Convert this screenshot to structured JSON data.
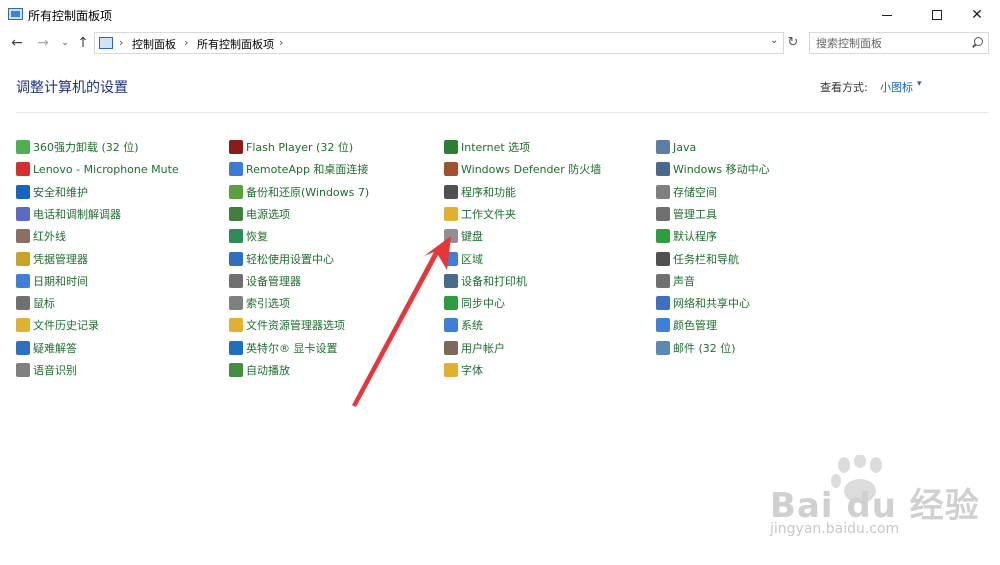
{
  "window": {
    "title": "所有控制面板项",
    "minimize_icon": "minimize-icon",
    "maximize_icon": "maximize-icon",
    "close_glyph": "✕"
  },
  "nav": {
    "back_glyph": "←",
    "forward_glyph": "→",
    "recent_glyph": "⌄",
    "up_glyph": "↑",
    "breadcrumb": [
      "控制面板",
      "所有控制面板项"
    ],
    "separator": "›",
    "dropdown_glyph": "⌄",
    "refresh_glyph": "↻"
  },
  "search": {
    "placeholder": "搜索控制面板"
  },
  "header": {
    "title": "调整计算机的设置",
    "view_label": "查看方式:",
    "view_value": "小图标",
    "view_caret": "▾"
  },
  "columns": [
    [
      {
        "label": "360强力卸载 (32 位)",
        "icon": "uninstall-icon",
        "color": "#4caf50"
      },
      {
        "label": "Lenovo - Microphone Mute",
        "icon": "lenovo-mute-icon",
        "color": "#d32f2f"
      },
      {
        "label": "安全和维护",
        "icon": "flag-icon",
        "color": "#1565c0"
      },
      {
        "label": "电话和调制解调器",
        "icon": "modem-icon",
        "color": "#5c6bc0"
      },
      {
        "label": "红外线",
        "icon": "infrared-icon",
        "color": "#8d6e63"
      },
      {
        "label": "凭据管理器",
        "icon": "credential-icon",
        "color": "#c9a227"
      },
      {
        "label": "日期和时间",
        "icon": "clock-icon",
        "color": "#3f7fd6"
      },
      {
        "label": "鼠标",
        "icon": "mouse-icon",
        "color": "#707070"
      },
      {
        "label": "文件历史记录",
        "icon": "file-history-icon",
        "color": "#e0b030"
      },
      {
        "label": "疑难解答",
        "icon": "troubleshoot-icon",
        "color": "#2f6fbf"
      },
      {
        "label": "语音识别",
        "icon": "microphone-icon",
        "color": "#808080"
      }
    ],
    [
      {
        "label": "Flash Player (32 位)",
        "icon": "flash-icon",
        "color": "#8b1a1a"
      },
      {
        "label": "RemoteApp 和桌面连接",
        "icon": "remoteapp-icon",
        "color": "#3a7bd5"
      },
      {
        "label": "备份和还原(Windows 7)",
        "icon": "backup-icon",
        "color": "#5aa03c"
      },
      {
        "label": "电源选项",
        "icon": "power-icon",
        "color": "#3f7f3f"
      },
      {
        "label": "恢复",
        "icon": "recovery-icon",
        "color": "#2e8b57"
      },
      {
        "label": "轻松使用设置中心",
        "icon": "accessibility-icon",
        "color": "#2f6fbf"
      },
      {
        "label": "设备管理器",
        "icon": "device-manager-icon",
        "color": "#707070"
      },
      {
        "label": "索引选项",
        "icon": "index-icon",
        "color": "#808080"
      },
      {
        "label": "文件资源管理器选项",
        "icon": "folder-options-icon",
        "color": "#e0b030"
      },
      {
        "label": "英特尔® 显卡设置",
        "icon": "intel-graphics-icon",
        "color": "#1e6fbf"
      },
      {
        "label": "自动播放",
        "icon": "autoplay-icon",
        "color": "#3f8f3f"
      }
    ],
    [
      {
        "label": "Internet 选项",
        "icon": "internet-icon",
        "color": "#2e7d32"
      },
      {
        "label": "Windows Defender 防火墙",
        "icon": "firewall-icon",
        "color": "#a0522d"
      },
      {
        "label": "程序和功能",
        "icon": "programs-icon",
        "color": "#505050"
      },
      {
        "label": "工作文件夹",
        "icon": "work-folder-icon",
        "color": "#e0b030"
      },
      {
        "label": "键盘",
        "icon": "keyboard-icon",
        "color": "#909090"
      },
      {
        "label": "区域",
        "icon": "region-icon",
        "color": "#3f7fd6"
      },
      {
        "label": "设备和打印机",
        "icon": "printer-icon",
        "color": "#4a6a8a"
      },
      {
        "label": "同步中心",
        "icon": "sync-icon",
        "color": "#2e9d3e"
      },
      {
        "label": "系统",
        "icon": "system-icon",
        "color": "#3f7fd6"
      },
      {
        "label": "用户帐户",
        "icon": "user-accounts-icon",
        "color": "#7a6a5a"
      },
      {
        "label": "字体",
        "icon": "font-icon",
        "color": "#e0b030"
      }
    ],
    [
      {
        "label": "Java",
        "icon": "java-icon",
        "color": "#5b7fa6"
      },
      {
        "label": "Windows 移动中心",
        "icon": "mobility-icon",
        "color": "#4a6a8a"
      },
      {
        "label": "存储空间",
        "icon": "storage-icon",
        "color": "#808080"
      },
      {
        "label": "管理工具",
        "icon": "admin-tools-icon",
        "color": "#707070"
      },
      {
        "label": "默认程序",
        "icon": "default-programs-icon",
        "color": "#2e9d3e"
      },
      {
        "label": "任务栏和导航",
        "icon": "taskbar-icon",
        "color": "#505050"
      },
      {
        "label": "声音",
        "icon": "speaker-icon",
        "color": "#707070"
      },
      {
        "label": "网络和共享中心",
        "icon": "network-icon",
        "color": "#3f6fbf"
      },
      {
        "label": "颜色管理",
        "icon": "color-management-icon",
        "color": "#3f7fd6"
      },
      {
        "label": "邮件 (32 位)",
        "icon": "mail-icon",
        "color": "#5a8ab0"
      }
    ]
  ],
  "annotation": {
    "arrow_color": "#e8353a"
  },
  "watermark": {
    "logo": "Bai du 经验",
    "url": "jingyan.baidu.com"
  }
}
